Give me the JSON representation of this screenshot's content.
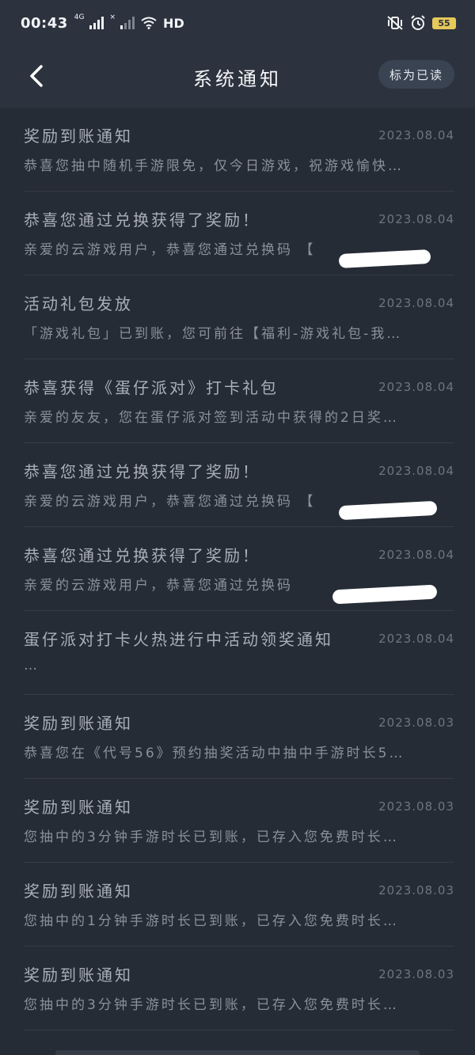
{
  "status_bar": {
    "time": "00:43",
    "net1": "4G",
    "net2": "×",
    "hd": "HD",
    "battery": "55",
    "icons": [
      "signal-icon",
      "wifi-icon",
      "vibrate-icon",
      "alarm-icon",
      "battery-icon"
    ]
  },
  "header": {
    "title": "系统通知",
    "mark_read": "标为已读",
    "back_icon": "back-arrow-icon"
  },
  "notifications": [
    {
      "title": "奖励到账通知",
      "date": "2023.08.04",
      "body": "恭喜您抽中随机手游限免，仅今日游戏，祝游戏愉快…"
    },
    {
      "title": "恭喜您通过兑换获得了奖励！",
      "date": "2023.08.04",
      "body": "亲爱的云游戏用户，恭喜您通过兑换码 【",
      "redacted": true
    },
    {
      "title": "活动礼包发放",
      "date": "2023.08.04",
      "body": "「游戏礼包」已到账，您可前往【福利-游戏礼包-我…"
    },
    {
      "title": "恭喜获得《蛋仔派对》打卡礼包",
      "date": "2023.08.04",
      "body": "亲爱的友友，您在蛋仔派对签到活动中获得的2日奖…"
    },
    {
      "title": "恭喜您通过兑换获得了奖励！",
      "date": "2023.08.04",
      "body": "亲爱的云游戏用户，恭喜您通过兑换码 【",
      "redacted": true
    },
    {
      "title": "恭喜您通过兑换获得了奖励！",
      "date": "2023.08.04",
      "body": "亲爱的云游戏用户，恭喜您通过兑换码",
      "redacted": true
    },
    {
      "title": "蛋仔派对打卡火热进行中活动领奖通知",
      "date": "2023.08.04",
      "body": "…"
    },
    {
      "title": "奖励到账通知",
      "date": "2023.08.03",
      "body": "恭喜您在《代号56》预约抽奖活动中抽中手游时长5…"
    },
    {
      "title": "奖励到账通知",
      "date": "2023.08.03",
      "body": "您抽中的3分钟手游时长已到账，已存入您免费时长…"
    },
    {
      "title": "奖励到账通知",
      "date": "2023.08.03",
      "body": "您抽中的1分钟手游时长已到账，已存入您免费时长…"
    },
    {
      "title": "奖励到账通知",
      "date": "2023.08.03",
      "body": "您抽中的3分钟手游时长已到账，已存入您免费时长…"
    }
  ]
}
